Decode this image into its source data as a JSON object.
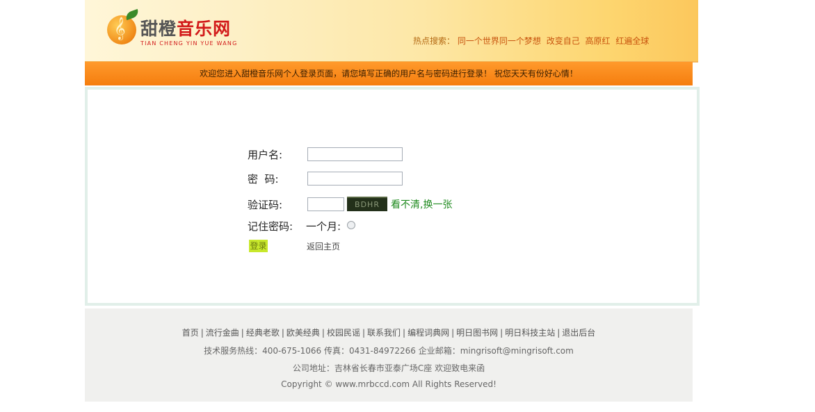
{
  "header": {
    "logo_main_part1": "甜橙",
    "logo_main_part2": "音乐网",
    "logo_sub": "TIAN CHENG YIN YUE WANG",
    "logo_clef": "𝄞",
    "hot_label": "热点搜索：",
    "hot_links": [
      "同一个世界同一个梦想",
      "改变自己",
      "高原红",
      "红遍全球"
    ]
  },
  "notice": "欢迎您进入甜橙音乐网个人登录页面，请您填写正确的用户名与密码进行登录！ 祝您天天有份好心情！",
  "form": {
    "username_label": "用户名:",
    "password_label": "密  码:",
    "captcha_label": "验证码:",
    "captcha_text": "BDHR",
    "captcha_refresh": "看不清,换一张",
    "remember_label": "记住密码:",
    "remember_option": "一个月:",
    "login_button": "登录",
    "back_link": "返回主页",
    "username_value": "",
    "password_value": "",
    "captcha_value": ""
  },
  "footer": {
    "nav": [
      "首页",
      "流行金曲",
      "经典老歌",
      "欧美经典",
      "校园民谣",
      "联系我们",
      "编程词典网",
      "明日图书网",
      "明日科技主站",
      "退出后台"
    ],
    "contact": "技术服务热线：400-675-1066 传真：0431-84972266 企业邮箱：mingrisoft@mingrisoft.com",
    "address": "公司地址：吉林省长春市亚泰广场C座 欢迎致电来函",
    "copyright": "Copyright © www.mrbccd.com All Rights Reserved!"
  },
  "colors": {
    "notice_bg": "#f57d0e",
    "captcha_refresh": "#1e8a1e",
    "login_button_bg": "#c8e82c",
    "main_border": "#e1efe9"
  }
}
